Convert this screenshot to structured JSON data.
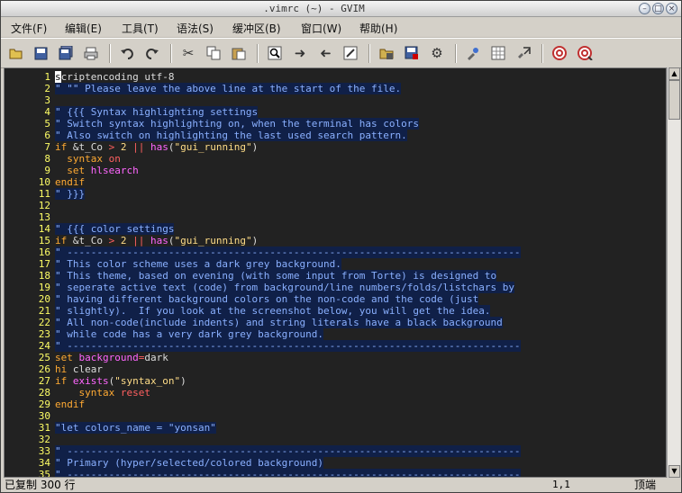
{
  "window": {
    "title": ".vimrc (~) - GVIM",
    "controls": [
      "minimize",
      "maximize",
      "close"
    ]
  },
  "menubar": {
    "items": [
      "文件(F)",
      "编辑(E)",
      "工具(T)",
      "语法(S)",
      "缓冲区(B)",
      "窗口(W)",
      "帮助(H)"
    ]
  },
  "toolbar": {
    "icons": [
      "open-icon",
      "save-icon",
      "save-all-icon",
      "print-icon",
      "undo-icon",
      "redo-icon",
      "cut-icon",
      "copy-icon",
      "paste-icon",
      "find-icon",
      "find-next-icon",
      "find-prev-icon",
      "replace-icon",
      "load-session-icon",
      "save-session-icon",
      "run-script-icon",
      "make-icon",
      "shell-icon",
      "ctags-icon",
      "help-icon",
      "find-help-icon"
    ]
  },
  "editor": {
    "lines": [
      {
        "n": "1",
        "tokens": [
          [
            "cur",
            "s"
          ],
          [
            "tx",
            "criptencoding utf-8"
          ]
        ]
      },
      {
        "n": "2",
        "tokens": [
          [
            "cm",
            "\" \"\" Please leave the above line at the start of the file."
          ]
        ]
      },
      {
        "n": "3",
        "tokens": []
      },
      {
        "n": "4",
        "tokens": [
          [
            "cm",
            "\" {{{ Syntax highlighting settings"
          ]
        ]
      },
      {
        "n": "5",
        "tokens": [
          [
            "cm",
            "\" Switch syntax highlighting on, when the terminal has colors"
          ]
        ]
      },
      {
        "n": "6",
        "tokens": [
          [
            "cm",
            "\" Also switch on highlighting the last used search pattern."
          ]
        ]
      },
      {
        "n": "7",
        "tokens": [
          [
            "kw",
            "if"
          ],
          [
            "tx",
            " &t_Co "
          ],
          [
            "op",
            ">"
          ],
          [
            "tx",
            " "
          ],
          [
            "nm",
            "2"
          ],
          [
            "tx",
            " "
          ],
          [
            "op",
            "||"
          ],
          [
            "tx",
            " "
          ],
          [
            "fn",
            "has"
          ],
          [
            "tx",
            "("
          ],
          [
            "st",
            "\"gui_running\""
          ],
          [
            "tx",
            ")"
          ]
        ]
      },
      {
        "n": "8",
        "tokens": [
          [
            "tx",
            "  "
          ],
          [
            "kw",
            "syntax"
          ],
          [
            "tx",
            " "
          ],
          [
            "op",
            "on"
          ]
        ]
      },
      {
        "n": "9",
        "tokens": [
          [
            "tx",
            "  "
          ],
          [
            "kw",
            "set"
          ],
          [
            "tx",
            " "
          ],
          [
            "vr",
            "hlsearch"
          ]
        ]
      },
      {
        "n": "10",
        "tokens": [
          [
            "kw",
            "endif"
          ]
        ]
      },
      {
        "n": "11",
        "tokens": [
          [
            "cm",
            "\" }}}"
          ]
        ]
      },
      {
        "n": "12",
        "tokens": []
      },
      {
        "n": "13",
        "tokens": []
      },
      {
        "n": "14",
        "tokens": [
          [
            "cm",
            "\" {{{ color settings"
          ]
        ]
      },
      {
        "n": "15",
        "tokens": [
          [
            "kw",
            "if"
          ],
          [
            "tx",
            " &t_Co "
          ],
          [
            "op",
            ">"
          ],
          [
            "tx",
            " "
          ],
          [
            "nm",
            "2"
          ],
          [
            "tx",
            " "
          ],
          [
            "op",
            "||"
          ],
          [
            "tx",
            " "
          ],
          [
            "fn",
            "has"
          ],
          [
            "tx",
            "("
          ],
          [
            "st",
            "\"gui_running\""
          ],
          [
            "tx",
            ")"
          ]
        ]
      },
      {
        "n": "16",
        "tokens": [
          [
            "cm",
            "\" ----------------------------------------------------------------------------"
          ]
        ]
      },
      {
        "n": "17",
        "tokens": [
          [
            "cm",
            "\" This color scheme uses a dark grey background."
          ]
        ]
      },
      {
        "n": "18",
        "tokens": [
          [
            "cm",
            "\" This theme, based on evening (with some input from Torte) is designed to"
          ]
        ]
      },
      {
        "n": "19",
        "tokens": [
          [
            "cm",
            "\" seperate active text (code) from background/line numbers/folds/listchars by"
          ]
        ]
      },
      {
        "n": "20",
        "tokens": [
          [
            "cm",
            "\" having different background colors on the non-code and the code (just"
          ]
        ]
      },
      {
        "n": "21",
        "tokens": [
          [
            "cm",
            "\" slightly).  If you look at the screenshot below, you will get the idea."
          ]
        ]
      },
      {
        "n": "22",
        "tokens": [
          [
            "cm",
            "\" All non-code(include indents) and string literals have a black background"
          ]
        ]
      },
      {
        "n": "23",
        "tokens": [
          [
            "cm",
            "\" while code has a very dark grey background."
          ]
        ]
      },
      {
        "n": "24",
        "tokens": [
          [
            "cm",
            "\" ----------------------------------------------------------------------------"
          ]
        ]
      },
      {
        "n": "25",
        "tokens": [
          [
            "kw",
            "set"
          ],
          [
            "tx",
            " "
          ],
          [
            "vr",
            "background"
          ],
          [
            "op",
            "="
          ],
          [
            "tx",
            "dark"
          ]
        ]
      },
      {
        "n": "26",
        "tokens": [
          [
            "kw",
            "hi"
          ],
          [
            "tx",
            " clear"
          ]
        ]
      },
      {
        "n": "27",
        "tokens": [
          [
            "kw",
            "if"
          ],
          [
            "tx",
            " "
          ],
          [
            "fn",
            "exists"
          ],
          [
            "tx",
            "("
          ],
          [
            "st",
            "\"syntax_on\""
          ],
          [
            "tx",
            ")"
          ]
        ]
      },
      {
        "n": "28",
        "tokens": [
          [
            "ib",
            "    "
          ],
          [
            "kw",
            "syntax"
          ],
          [
            "tx",
            " "
          ],
          [
            "op",
            "reset"
          ]
        ]
      },
      {
        "n": "29",
        "tokens": [
          [
            "kw",
            "endif"
          ]
        ]
      },
      {
        "n": "30",
        "tokens": []
      },
      {
        "n": "31",
        "tokens": [
          [
            "cm",
            "\"let colors_name = \"yonsan\""
          ]
        ]
      },
      {
        "n": "32",
        "tokens": []
      },
      {
        "n": "33",
        "tokens": [
          [
            "cm",
            "\" ----------------------------------------------------------------------------"
          ]
        ]
      },
      {
        "n": "34",
        "tokens": [
          [
            "cm",
            "\" Primary (hyper/selected/colored background)"
          ]
        ]
      },
      {
        "n": "35",
        "tokens": [
          [
            "cm",
            "\" ----------------------------------------------------------------------------"
          ]
        ]
      }
    ]
  },
  "statusbar": {
    "message": "已复制 300 行",
    "position": "1,1",
    "scroll": "顶端"
  },
  "colors": {
    "editor_bg": "#222222",
    "line_number": "#ffff66",
    "comment": "#8ab0ff",
    "comment_bg": "#102048",
    "keyword": "#ffaa33",
    "operator": "#ff6060",
    "function": "#ff66ff",
    "string": "#ffdd88",
    "text": "#dddddd"
  }
}
